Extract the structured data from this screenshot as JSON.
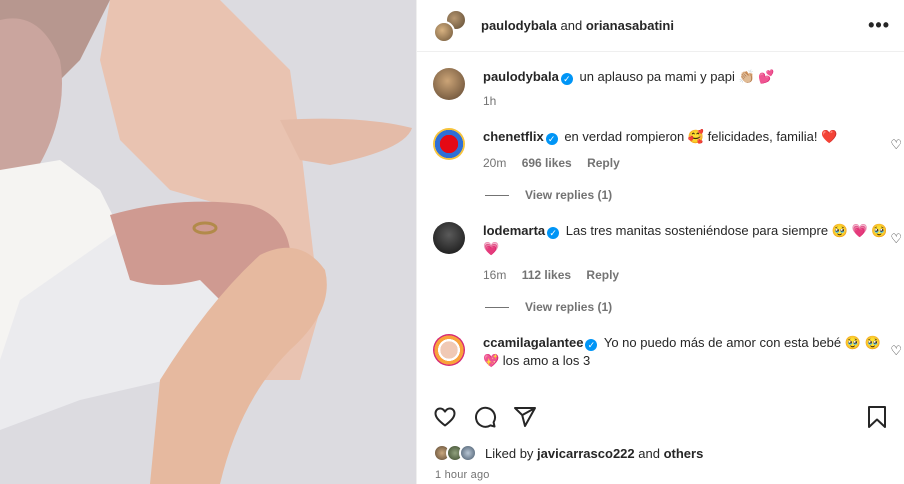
{
  "header": {
    "user1": "paulodybala",
    "connector": "and",
    "user2": "orianasabatini"
  },
  "caption": {
    "username": "paulodybala",
    "text": "un aplauso pa mami y papi 👏🏼 💕",
    "time": "1h"
  },
  "comments": [
    {
      "username": "chenetflix",
      "verified": true,
      "text": "en verdad rompieron 🥰 felicidades, familia! ❤️",
      "time": "20m",
      "likes": "696 likes",
      "reply": "Reply",
      "view_replies": "View replies (1)"
    },
    {
      "username": "lodemarta",
      "verified": true,
      "text": "Las tres manitas sosteniéndose para siempre 🥹 💗 🥹 💗",
      "time": "16m",
      "likes": "112 likes",
      "reply": "Reply",
      "view_replies": "View replies (1)"
    },
    {
      "username": "ccamilagalantee",
      "verified": true,
      "text": "Yo no puedo más de amor con esta bebé 🥹 🥹 💖 los amo a los 3"
    }
  ],
  "likes_line": {
    "prefix": "Liked by",
    "user": "javicarrasco222",
    "connector": "and",
    "others": "others"
  },
  "posted_ago": "1 hour ago",
  "colors": {
    "verified": "#0095f6",
    "secondary_text": "#737373",
    "primary_text": "#262626",
    "reaction_heart": "#ed4956"
  },
  "icons": [
    "more-icon",
    "heart-icon",
    "comment-icon",
    "share-icon",
    "bookmark-icon",
    "verified-icon"
  ]
}
